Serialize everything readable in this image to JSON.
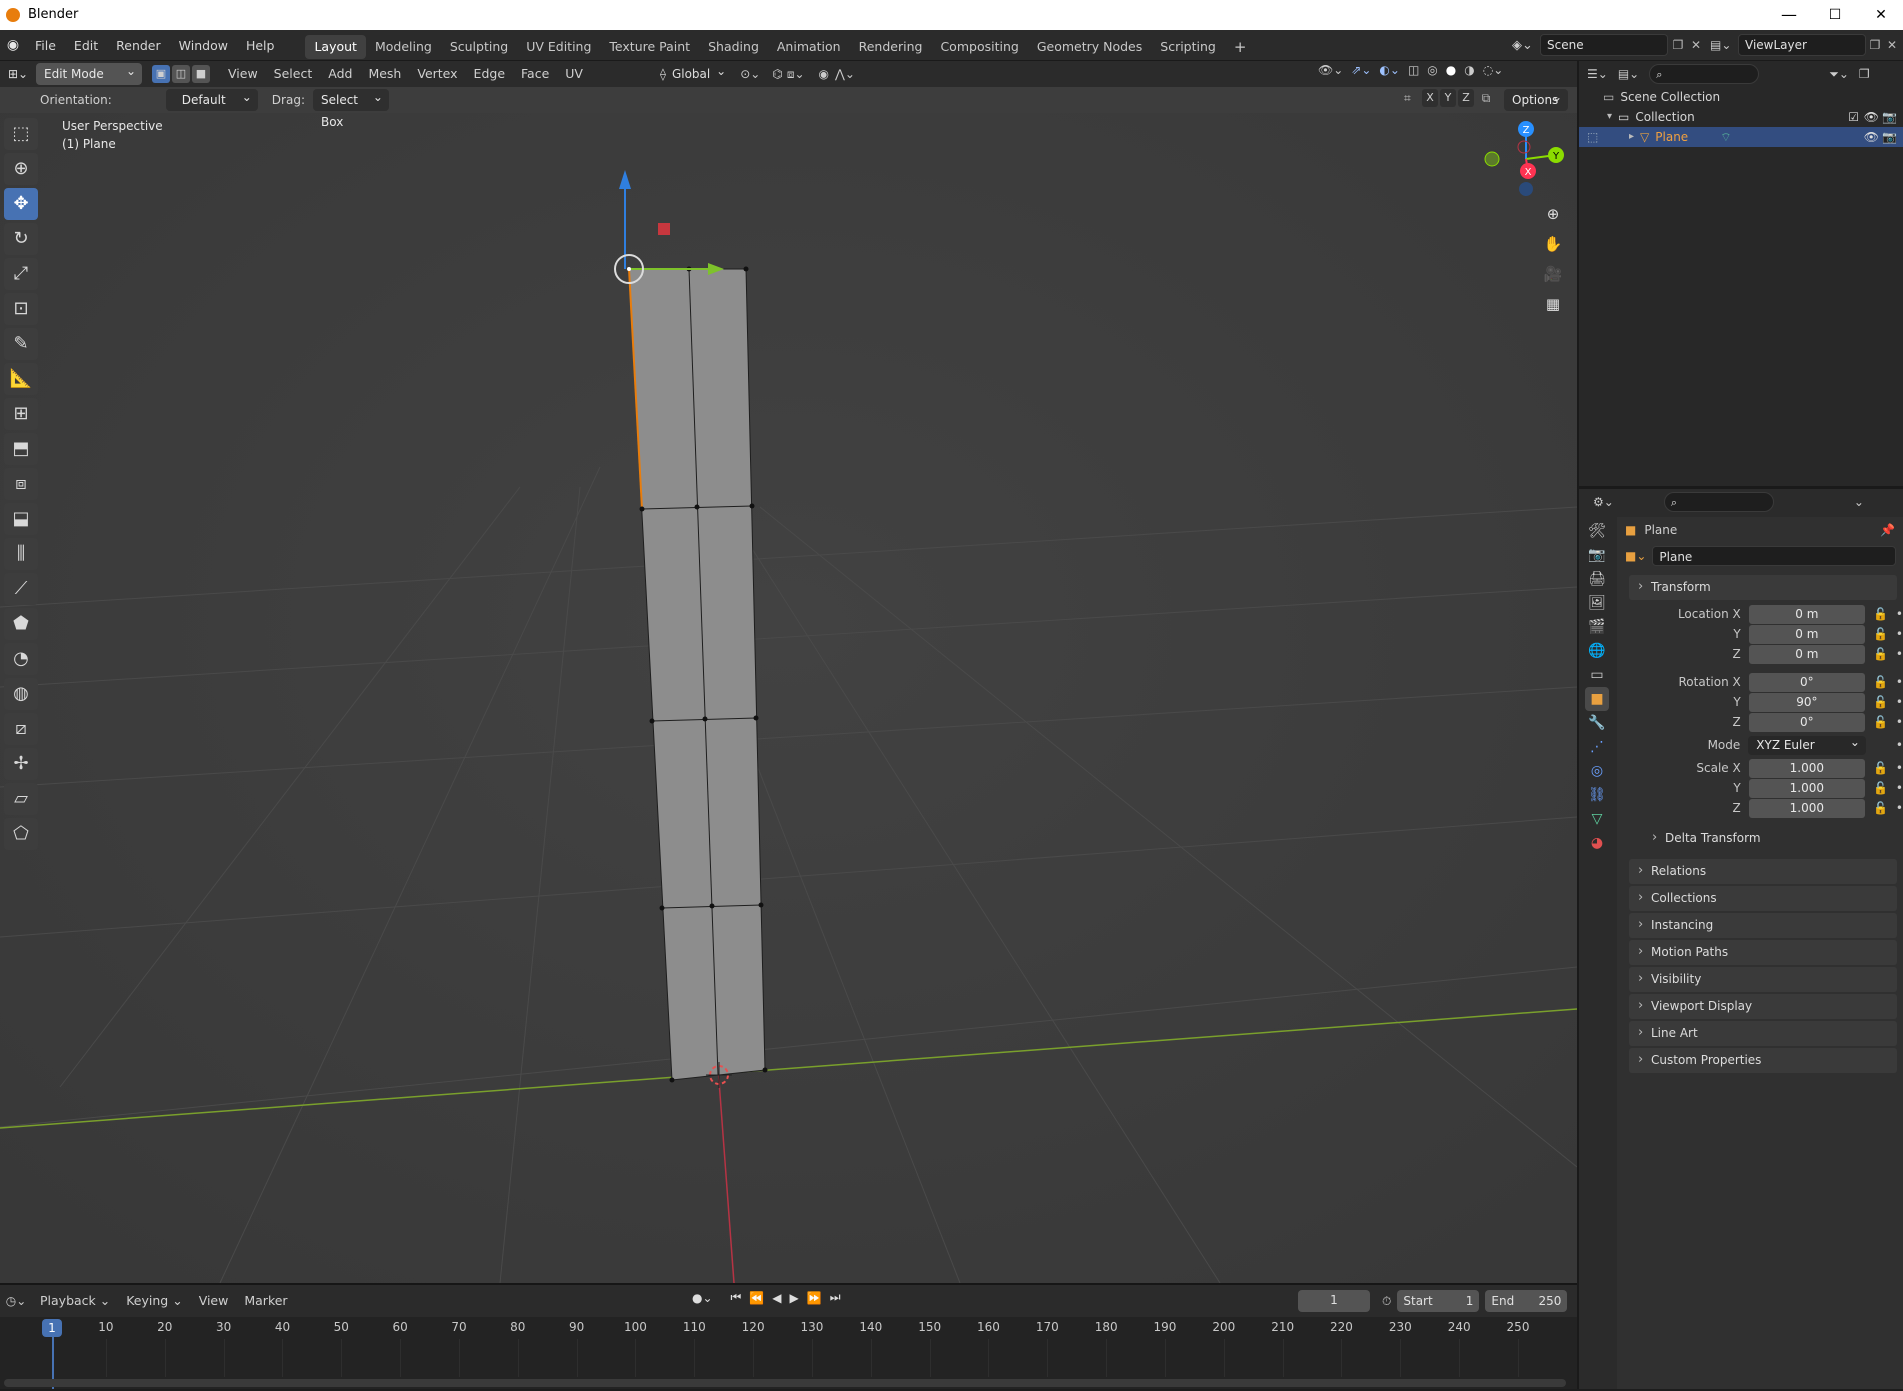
{
  "window": {
    "title": "Blender",
    "minimize": "—",
    "maximize": "☐",
    "close": "✕"
  },
  "menu": [
    "File",
    "Edit",
    "Render",
    "Window",
    "Help"
  ],
  "workspaces": [
    "Layout",
    "Modeling",
    "Sculpting",
    "UV Editing",
    "Texture Paint",
    "Shading",
    "Animation",
    "Rendering",
    "Compositing",
    "Geometry Nodes",
    "Scripting"
  ],
  "workspace_add": "+",
  "scene": {
    "scene_name": "Scene",
    "view_layer": "ViewLayer"
  },
  "viewport_header": {
    "mode": "Edit Mode",
    "menus": [
      "View",
      "Select",
      "Add",
      "Mesh",
      "Vertex",
      "Edge",
      "Face",
      "UV"
    ],
    "transform_space": "Global",
    "axes": [
      "X",
      "Y",
      "Z"
    ],
    "options": "Options"
  },
  "tool_header": {
    "orientation_label": "Orientation:",
    "orientation_value": "Default",
    "drag_label": "Drag:",
    "drag_value": "Select Box"
  },
  "viewport": {
    "perspective": "User Perspective",
    "object": "(1) Plane",
    "gizmo": {
      "z": "Z",
      "y": "Y",
      "x": "X"
    }
  },
  "outliner": {
    "scene_collection": "Scene Collection",
    "collection": "Collection",
    "object": "Plane"
  },
  "properties": {
    "header_name": "Plane",
    "object_name": "Plane",
    "transform": {
      "title": "Transform",
      "location": {
        "label": "Location X",
        "x": "0 m",
        "y": "0 m",
        "z": "0 m"
      },
      "rotation": {
        "label": "Rotation X",
        "x": "0°",
        "y": "90°",
        "z": "0°"
      },
      "mode_label": "Mode",
      "mode_value": "XYZ Euler",
      "scale": {
        "label": "Scale X",
        "x": "1.000",
        "y": "1.000",
        "z": "1.000"
      },
      "y_label": "Y",
      "z_label": "Z",
      "delta": "Delta Transform"
    },
    "panels": [
      "Relations",
      "Collections",
      "Instancing",
      "Motion Paths",
      "Visibility",
      "Viewport Display",
      "Line Art",
      "Custom Properties"
    ]
  },
  "timeline": {
    "menus": [
      "Playback",
      "Keying",
      "View",
      "Marker"
    ],
    "current_frame": "1",
    "start_label": "Start",
    "start": "1",
    "end_label": "End",
    "end": "250",
    "ticks": [
      "10",
      "20",
      "30",
      "40",
      "50",
      "60",
      "70",
      "80",
      "90",
      "100",
      "110",
      "120",
      "130",
      "140",
      "150",
      "160",
      "170",
      "180",
      "190",
      "200",
      "210",
      "220",
      "230",
      "240",
      "250"
    ],
    "playhead": "1"
  },
  "colors": {
    "accent": "#4772b3",
    "select": "#e87d0d",
    "x_axis": "#ff3352",
    "y_axis": "#8bdc00",
    "z_axis": "#2890ff"
  }
}
